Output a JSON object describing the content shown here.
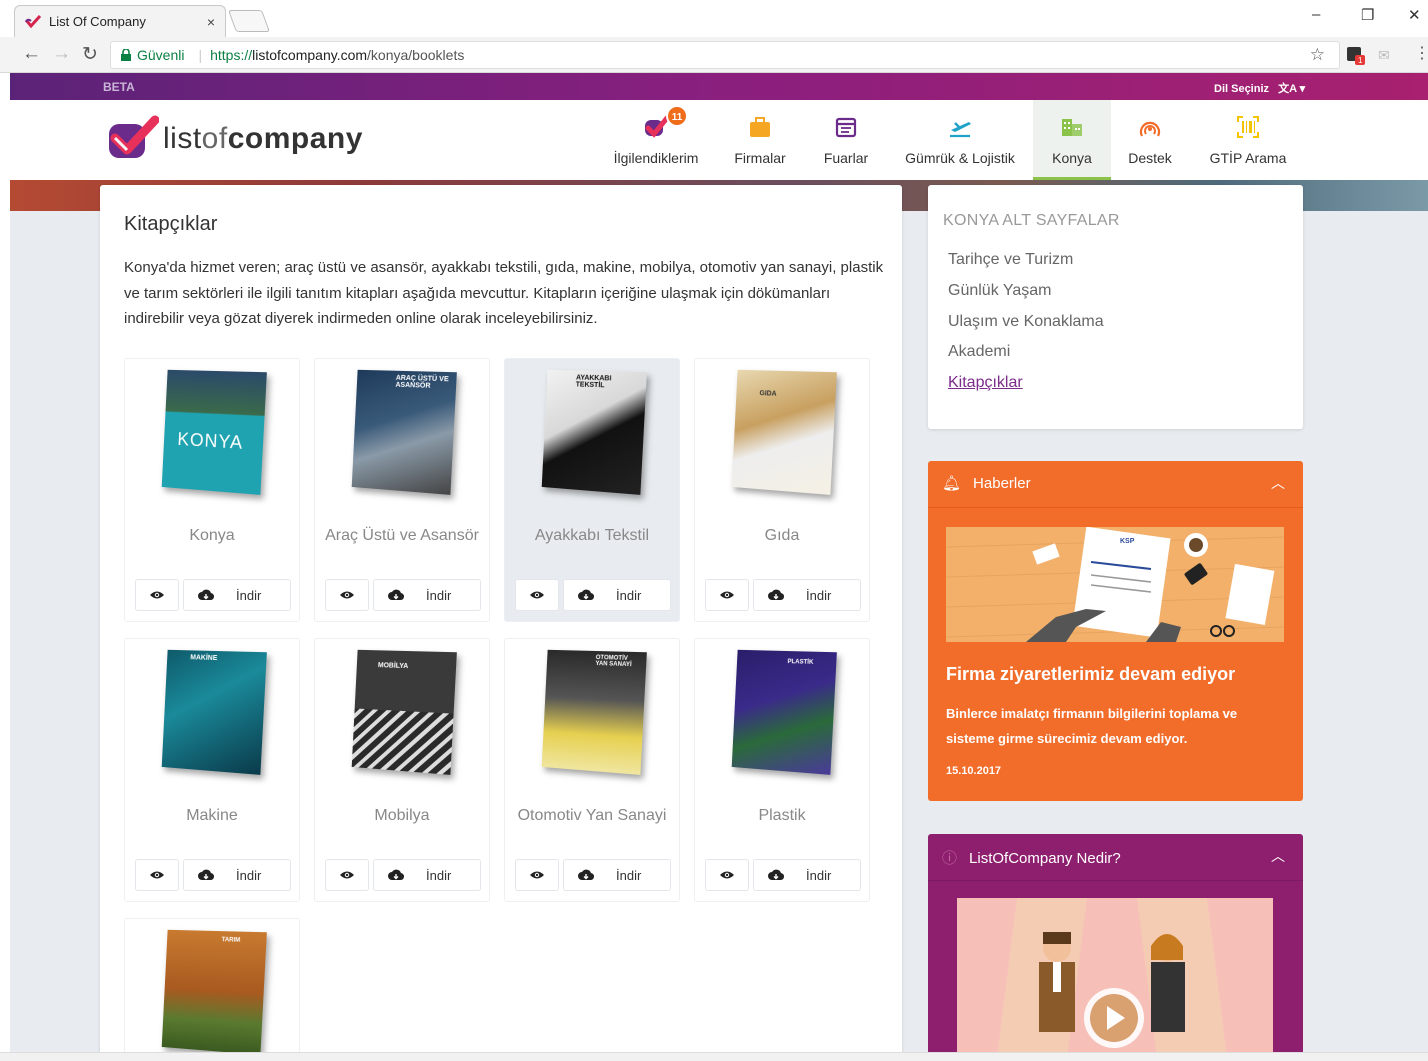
{
  "browser": {
    "tab_title": "List Of Company",
    "tab_close": "×",
    "secure_label": "Güvenli",
    "url_protocol": "https://",
    "url_host": "listofcompany.com",
    "url_path": "/konya/booklets",
    "ext_badge": "1",
    "win_min": "–",
    "win_max": "❐",
    "win_close": "✕"
  },
  "beta_bar": {
    "beta": "BETA",
    "language": "Dil Seçiniz"
  },
  "logo": {
    "part1": "list",
    "part2": "of",
    "part3": "company"
  },
  "nav": [
    {
      "label": "İlgilendiklerim",
      "icon": "checkmark-heart-icon",
      "badge": "11"
    },
    {
      "label": "Firmalar",
      "icon": "briefcase-icon"
    },
    {
      "label": "Fuarlar",
      "icon": "calendar-icon"
    },
    {
      "label": "Gümrük & Lojistik",
      "icon": "plane-takeoff-icon"
    },
    {
      "label": "Konya",
      "icon": "buildings-icon",
      "active": true
    },
    {
      "label": "Destek",
      "icon": "support-icon"
    },
    {
      "label": "GTİP Arama",
      "icon": "barcode-scan-icon"
    }
  ],
  "main": {
    "title": "Kitapçıklar",
    "description": "Konya'da hizmet veren; araç üstü ve asansör, ayakkabı tekstili, gıda, makine, mobilya, otomotiv yan sanayi, plastik ve tarım sektörleri ile ilgili tanıtım kitapları aşağıda mevcuttur. Kitapların içeriğine ulaşmak için dökümanları indirebilir veya gözat diyerek indirmeden online olarak inceleyebilirsiniz.",
    "download_label": "İndir",
    "books": [
      {
        "name": "Konya"
      },
      {
        "name": "Araç Üstü ve Asansör"
      },
      {
        "name": "Ayakkabı Tekstil"
      },
      {
        "name": "Gıda"
      },
      {
        "name": "Makine"
      },
      {
        "name": "Mobilya"
      },
      {
        "name": "Otomotiv Yan Sanayi"
      },
      {
        "name": "Plastik"
      },
      {
        "name": ""
      }
    ],
    "cover_texts": {
      "konya": "KONYA",
      "arac": "ARAÇ ÜSTÜ VE ASANSÖR",
      "ayakkabi": "AYAKKABI TEKSTİL",
      "gida": "GIDA",
      "makine": "MAKİNE",
      "mobilya": "MOBİLYA",
      "otomotiv": "OTOMOTİV YAN SANAYİ",
      "plastik": "PLASTİK",
      "tarim": "TARIM"
    }
  },
  "sidebar": {
    "title": "KONYA ALT SAYFALAR",
    "links": [
      "Tarihçe ve Turizm",
      "Günlük Yaşam",
      "Ulaşım ve Konaklama",
      "Akademi",
      "Kitapçıklar"
    ]
  },
  "news": {
    "header": "Haberler",
    "headline": "Firma ziyaretlerimiz devam ediyor",
    "body": "Binlerce imalatçı firmanın bilgilerini toplama ve sisteme girme sürecimiz devam ediyor.",
    "date": "15.10.2017",
    "image_doc_text": "KSP"
  },
  "what_is": {
    "header": "ListOfCompany Nedir?"
  },
  "colors": {
    "accent_purple": "#8e1f6e",
    "accent_orange": "#f26c2a",
    "nav_active": "#8bc34a"
  }
}
